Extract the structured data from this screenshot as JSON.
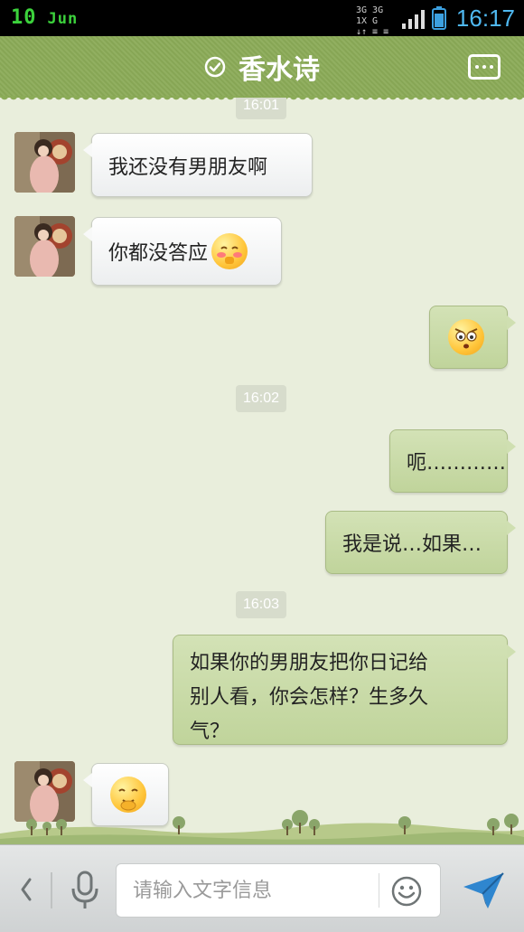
{
  "status_bar": {
    "date_day": "10",
    "date_month": "Jun",
    "network_line1": "3G 3G 1X G",
    "network_line2": "↓↑ ≡ ≡",
    "time": "16:17",
    "colors": {
      "date": "#3cd23c",
      "time": "#4fb8f0"
    }
  },
  "header": {
    "title": "香水诗",
    "check_icon": "check-circle-icon",
    "menu_icon": "more-options-icon",
    "background": "#8bab58"
  },
  "messages": {
    "time_1601": "16:01",
    "m1": "我还没有男朋友啊",
    "m2": "你都没答应",
    "time_1602": "16:02",
    "m4": "呃…………",
    "m5": "我是说…如果…",
    "time_1603": "16:03",
    "m6_line1": "如果你的男朋友把你日记给",
    "m6_line2": "别人看，你会怎样？生多久",
    "m6_line3": "气？",
    "emoji_names": [
      "shy-blush-emoji",
      "angry-emoji",
      "giggle-emoji"
    ]
  },
  "input_bar": {
    "placeholder": "请输入文字信息",
    "back_icon": "chevron-left-icon",
    "mic_icon": "microphone-icon",
    "emoji_icon": "smiley-icon",
    "send_icon": "send-paper-plane-icon"
  }
}
